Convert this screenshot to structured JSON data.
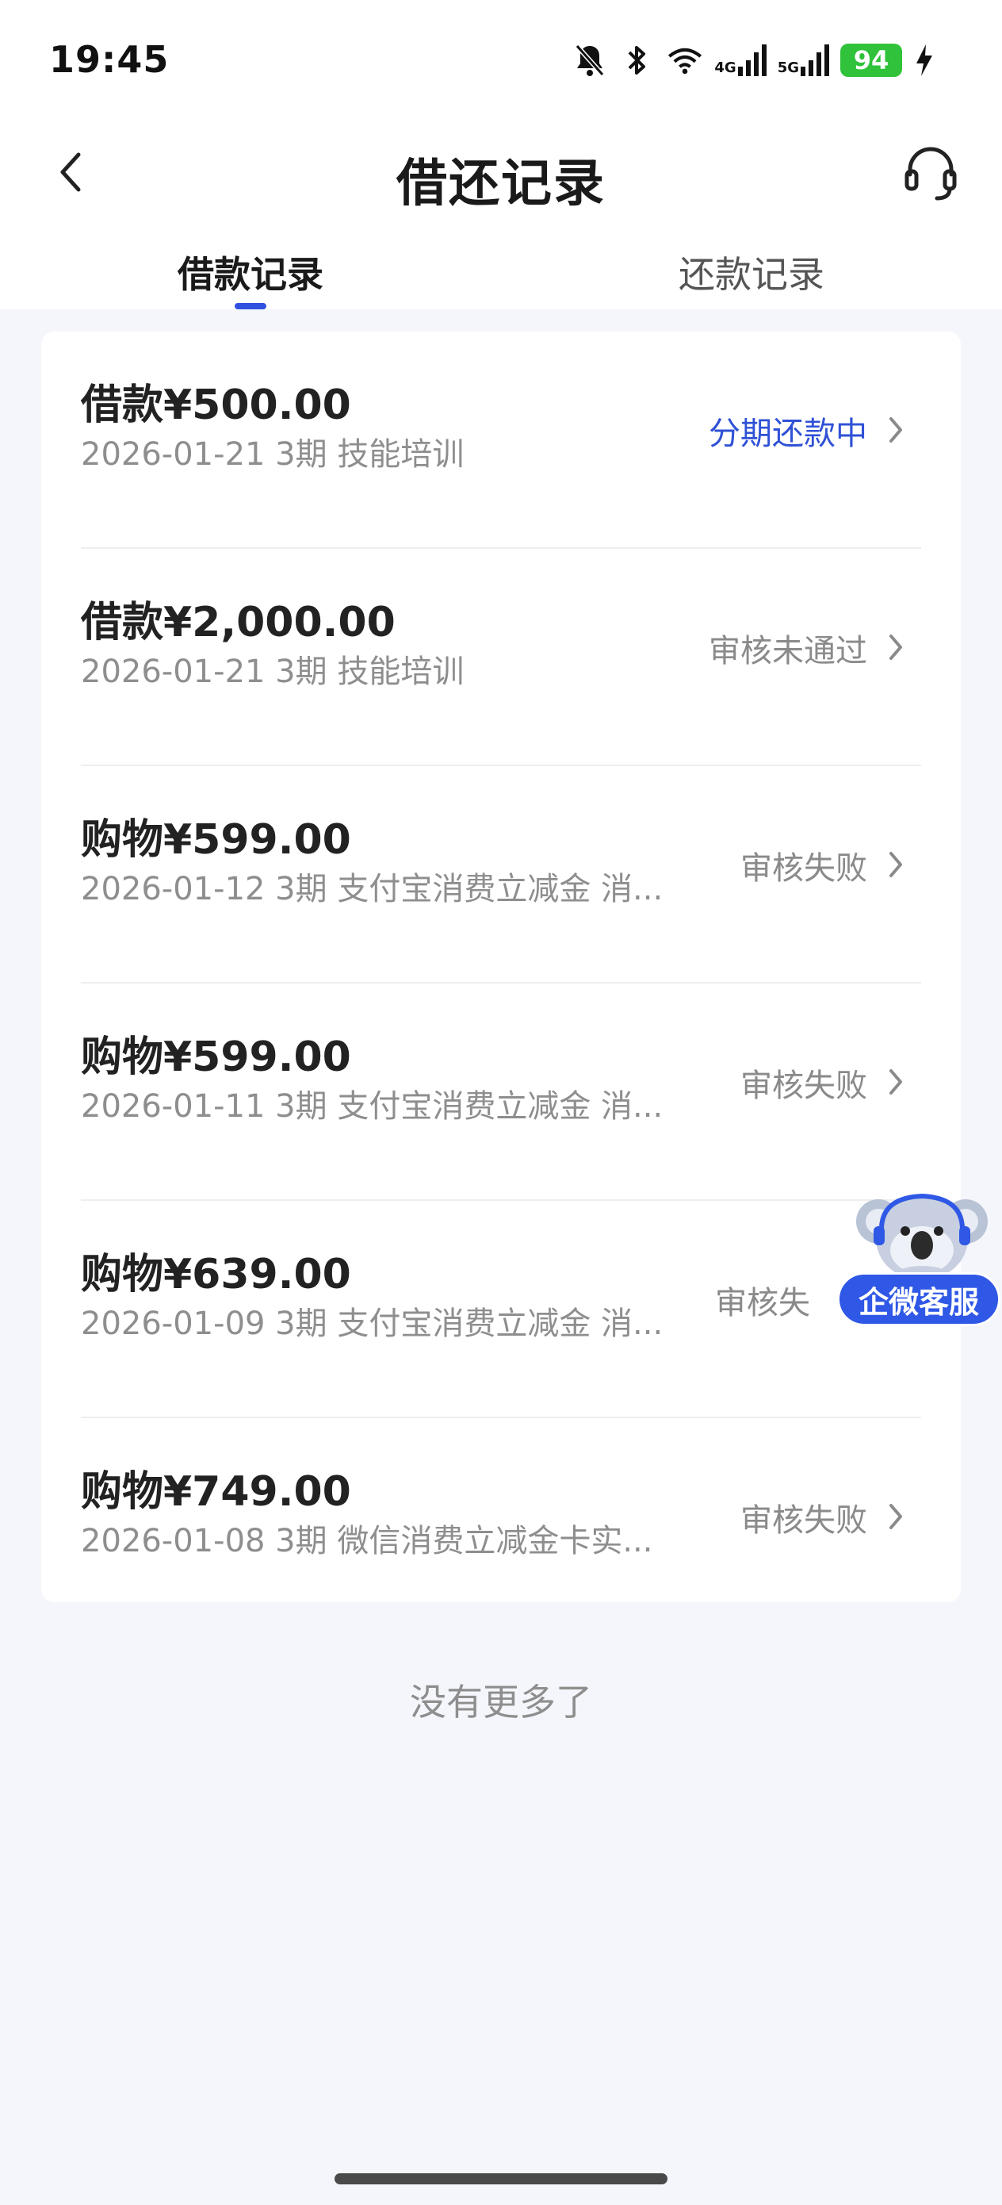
{
  "status_bar": {
    "time": "19:45",
    "battery": "94",
    "net1_label": "4G",
    "net2_label": "5G",
    "icons": [
      "bell-off-icon",
      "bluetooth-icon",
      "wifi-icon",
      "signal-icon",
      "signal-icon",
      "battery-icon",
      "charging-icon"
    ]
  },
  "header": {
    "title": "借还记录",
    "back_icon": "chevron-left-icon",
    "service_icon": "headset-icon"
  },
  "tabs": [
    {
      "label": "借款记录",
      "active": true
    },
    {
      "label": "还款记录",
      "active": false
    }
  ],
  "records": [
    {
      "amount": "借款¥500.00",
      "detail": "2026-01-21 3期  技能培训",
      "status": "分期还款中",
      "status_color": "#2f51d6"
    },
    {
      "amount": "借款¥2,000.00",
      "detail": "2026-01-21 3期  技能培训",
      "status": "审核未通过",
      "status_color": "#8a8a8a"
    },
    {
      "amount": "购物¥599.00",
      "detail": "2026-01-12 3期  支付宝消费立减金 消...",
      "status": "审核失败",
      "status_color": "#8a8a8a"
    },
    {
      "amount": "购物¥599.00",
      "detail": "2026-01-11 3期  支付宝消费立减金 消...",
      "status": "审核失败",
      "status_color": "#8a8a8a"
    },
    {
      "amount": "购物¥639.00",
      "detail": "2026-01-09 3期  支付宝消费立减金 消...",
      "status": "审核失",
      "status_color": "#8a8a8a"
    },
    {
      "amount": "购物¥749.00",
      "detail": "2026-01-08 3期  微信消费立减金卡实...",
      "status": "审核失败",
      "status_color": "#8a8a8a"
    }
  ],
  "footer": {
    "no_more": "没有更多了"
  },
  "floating_service": {
    "label": "企微客服",
    "icon": "koala-mascot-icon"
  },
  "colors": {
    "accent": "#2f51d6",
    "background": "#f5f6fb",
    "pill": "#2f58e6",
    "battery": "#2fc23a"
  }
}
